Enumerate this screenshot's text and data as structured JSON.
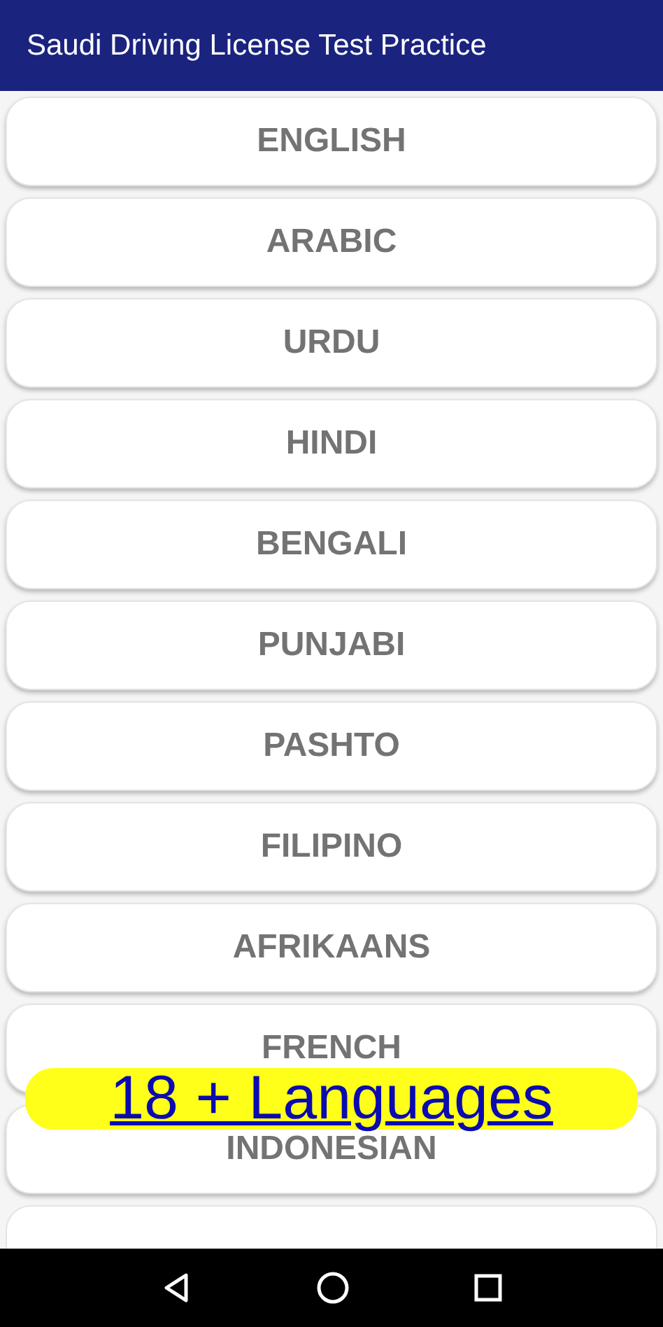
{
  "app_bar": {
    "title": "Saudi Driving License Test Practice"
  },
  "languages": [
    "ENGLISH",
    "ARABIC",
    "URDU",
    "HINDI",
    "BENGALI",
    "PUNJABI",
    "PASHTO",
    "FILIPINO",
    "AFRIKAANS",
    "FRENCH",
    "INDONESIAN"
  ],
  "banner": {
    "text": "18 + Languages"
  }
}
